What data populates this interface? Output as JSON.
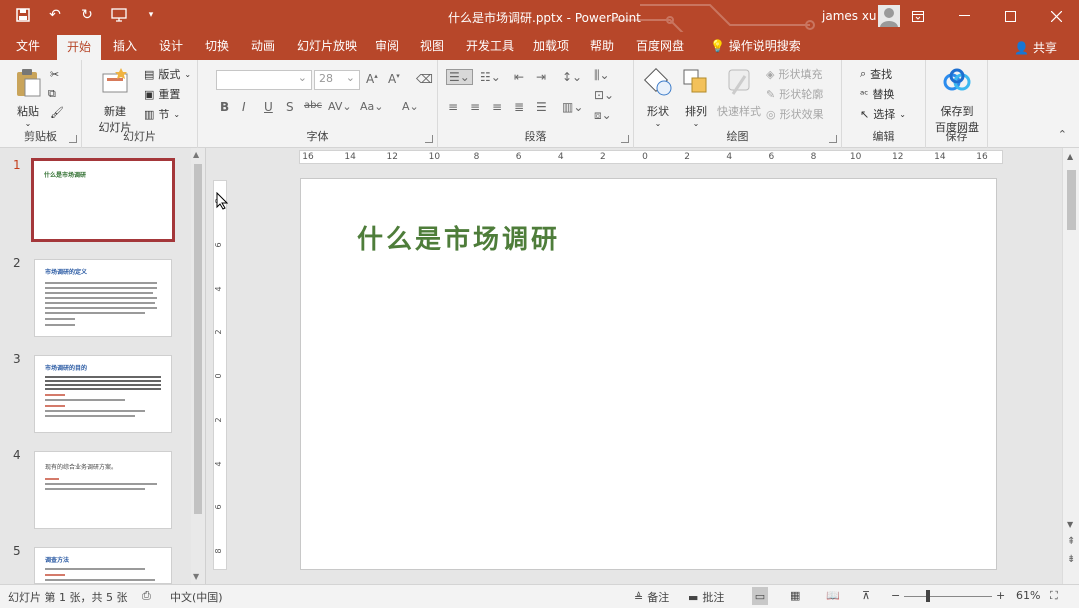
{
  "titlebar": {
    "document_title": "什么是市场调研.pptx  -  PowerPoint",
    "user_name": "james xu",
    "bg_color": "#b7472a",
    "qat_icons": [
      "save-icon",
      "undo-icon",
      "redo-icon",
      "start-from-beginning-icon",
      "customize-qat-icon"
    ],
    "window_buttons": [
      "ribbon-display-options-icon",
      "minimize-icon",
      "maximize-icon",
      "close-icon"
    ]
  },
  "tabs": {
    "items": [
      "文件",
      "开始",
      "插入",
      "设计",
      "切换",
      "动画",
      "幻灯片放映",
      "审阅",
      "视图",
      "开发工具",
      "加载项",
      "帮助",
      "百度网盘"
    ],
    "active": "开始",
    "tell_me": "操作说明搜索",
    "share": "共享"
  },
  "ribbon": {
    "clipboard": {
      "label": "剪贴板",
      "paste": "粘贴"
    },
    "slides": {
      "label": "幻灯片",
      "new_slide": "新建",
      "new_slide_2": "幻灯片",
      "layout": "版式",
      "reset": "重置",
      "section": "节"
    },
    "font": {
      "label": "字体",
      "font_name": "",
      "font_size": "28"
    },
    "paragraph": {
      "label": "段落"
    },
    "drawing": {
      "label": "绘图",
      "shapes": "形状",
      "arrange": "排列",
      "quick_styles": "快速样式",
      "shape_fill": "形状填充",
      "shape_outline": "形状轮廓",
      "shape_effects": "形状效果"
    },
    "editing": {
      "label": "编辑",
      "find": "查找",
      "replace": "替换",
      "select": "选择"
    },
    "save": {
      "label": "保存",
      "save_to": "保存到",
      "baidu": "百度网盘"
    }
  },
  "thumbnails": [
    {
      "num": "1",
      "title": "什么是市场调研",
      "selected": true
    },
    {
      "num": "2",
      "title": "市场调研的定义",
      "selected": false
    },
    {
      "num": "3",
      "title": "市场调研的目的",
      "selected": false
    },
    {
      "num": "4",
      "title": "现有的综合业务调研方案。",
      "selected": false
    },
    {
      "num": "5",
      "title": "调查方法",
      "selected": false
    }
  ],
  "slide": {
    "title": "什么是市场调研",
    "title_color": "#4e7d3a"
  },
  "ruler": {
    "h": [
      "16",
      "14",
      "12",
      "10",
      "8",
      "6",
      "4",
      "2",
      "0",
      "2",
      "4",
      "6",
      "8",
      "10",
      "12",
      "14",
      "16"
    ],
    "v": [
      "8",
      "6",
      "4",
      "2",
      "0",
      "2",
      "4",
      "6",
      "8"
    ]
  },
  "status": {
    "slide_info": "幻灯片 第 1 张，共 5 张",
    "language": "中文(中国)",
    "notes": "备注",
    "comments": "批注",
    "zoom": "61%"
  }
}
